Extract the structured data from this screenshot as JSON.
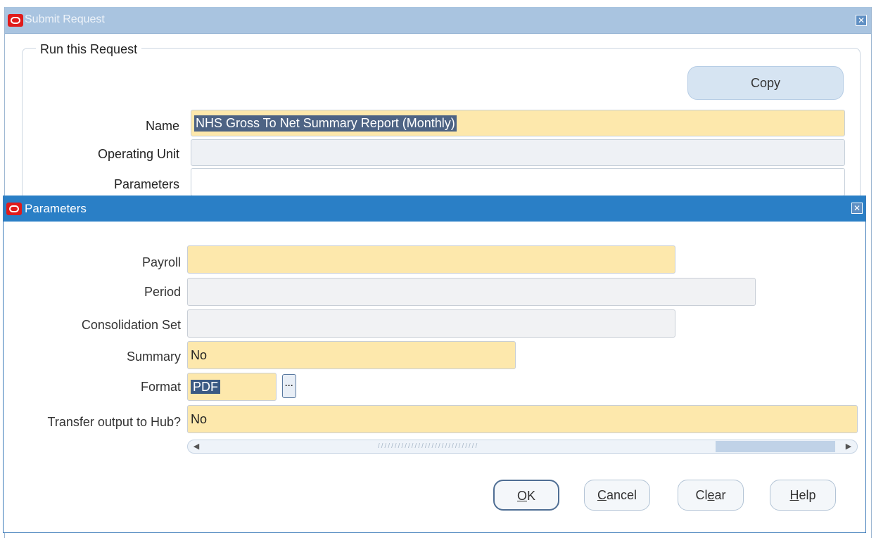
{
  "submit_request": {
    "title": "Submit Request",
    "group_label": "Run this Request",
    "copy_label": "Copy",
    "fields": {
      "name_label": "Name",
      "name_value": "NHS Gross To Net Summary Report (Monthly)",
      "operating_unit_label": "Operating Unit",
      "operating_unit_value": "",
      "parameters_label": "Parameters",
      "parameters_value": ""
    }
  },
  "parameters": {
    "title": "Parameters",
    "fields": {
      "payroll_label": "Payroll",
      "payroll_value": "",
      "period_label": "Period",
      "period_value": "",
      "consolidation_set_label": "Consolidation Set",
      "consolidation_set_value": "",
      "summary_label": "Summary",
      "summary_value": "No",
      "format_label": "Format",
      "format_value": "PDF",
      "transfer_label": "Transfer output to Hub?",
      "transfer_value": "No"
    },
    "buttons": {
      "ok_mnemonic": "O",
      "ok_rest": "K",
      "cancel_mnemonic": "C",
      "cancel_rest": "ancel",
      "clear_first": "Cl",
      "clear_mnemonic": "e",
      "clear_rest": "ar",
      "help_mnemonic": "H",
      "help_rest": "elp"
    }
  },
  "colors": {
    "required_field": "#fde8ac",
    "inactive_title": "#a9c4e0",
    "active_title": "#2a7fc6",
    "oracle_icon": "#e01b1b"
  }
}
